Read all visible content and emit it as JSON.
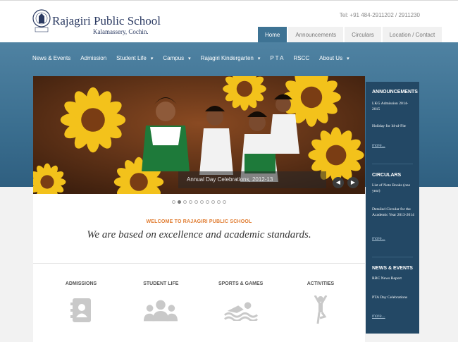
{
  "header": {
    "school_name": "Rajagiri Public School",
    "school_sub": "Kalamassery, Cochin.",
    "tel": "Tel: +91 484-2911202 / 2911230"
  },
  "top_tabs": [
    "Home",
    "Announcements",
    "Circulars",
    "Location / Contact"
  ],
  "nav": [
    {
      "label": "News & Events",
      "dropdown": false
    },
    {
      "label": "Admission",
      "dropdown": false
    },
    {
      "label": "Student Life",
      "dropdown": true
    },
    {
      "label": "Campus",
      "dropdown": true
    },
    {
      "label": "Rajagiri Kindergarten",
      "dropdown": true
    },
    {
      "label": "P T A",
      "dropdown": false
    },
    {
      "label": "RSCC",
      "dropdown": false
    },
    {
      "label": "About Us",
      "dropdown": true
    }
  ],
  "slider": {
    "caption": "Annual Day Celebrations, 2012-13",
    "dot_count": 10,
    "active_dot": 2
  },
  "welcome": "WELCOME TO RAJAGIRI PUBLIC SCHOOL",
  "tagline": "We are based on excellence and academic standards.",
  "sections": [
    "ADMISSIONS",
    "STUDENT LIFE",
    "SPORTS & GAMES",
    "ACTIVITIES"
  ],
  "sidebar": {
    "announcements": {
      "title": "ANNOUNCEMENTS",
      "items": [
        "LKG Admission 2014-2015",
        "Holiday for Id-ul-Fitr"
      ],
      "more": "more..."
    },
    "circulars": {
      "title": "CIRCULARS",
      "items": [
        "List of Note Books (one year)",
        "Detailed Circular for the Academic Year 2013-2014"
      ],
      "more": "more..."
    },
    "news": {
      "title": "NEWS & EVENTS",
      "items": [
        "RBC News Report",
        "PTA Day Celebrations"
      ],
      "more": "more..."
    }
  },
  "colors": {
    "primary_blue": "#3e7394",
    "sidebar": "#234865",
    "accent_orange": "#e07b2f"
  }
}
